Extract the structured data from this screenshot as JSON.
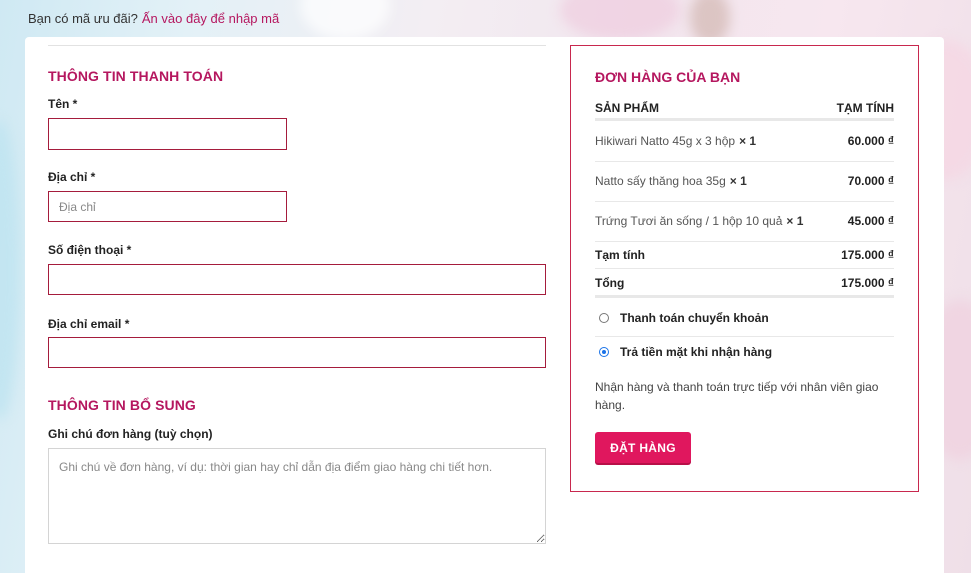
{
  "coupon": {
    "prompt": "Bạn có mã ưu đãi?",
    "link": "Ấn vào đây để nhập mã"
  },
  "billing": {
    "title": "THÔNG TIN THANH TOÁN",
    "name_label": "Tên *",
    "name_value": "",
    "address_label": "Địa chỉ *",
    "address_placeholder": "Địa chỉ",
    "phone_label": "Số điện thoại *",
    "phone_value": "",
    "email_label": "Địa chỉ email *",
    "email_value": ""
  },
  "additional": {
    "title": "THÔNG TIN BỔ SUNG",
    "notes_label": "Ghi chú đơn hàng (tuỳ chọn)",
    "notes_placeholder": "Ghi chú về đơn hàng, ví dụ: thời gian hay chỉ dẫn địa điểm giao hàng chi tiết hơn."
  },
  "order": {
    "title": "ĐƠN HÀNG CỦA BẠN",
    "col_product": "SẢN PHẨM",
    "col_subtotal": "TẠM TÍNH",
    "items": [
      {
        "name": "Hikiwari Natto 45g x 3 hộp",
        "qty": "× 1",
        "price": "60.000 ₫"
      },
      {
        "name": "Natto sấy thăng hoa 35g",
        "qty": "× 1",
        "price": "70.000 ₫"
      },
      {
        "name": "Trứng Tươi ăn sống / 1 hộp 10 quả",
        "qty": "× 1",
        "price": "45.000 ₫"
      }
    ],
    "subtotal_label": "Tạm tính",
    "subtotal_value": "175.000 ₫",
    "total_label": "Tổng",
    "total_value": "175.000 ₫"
  },
  "payment": {
    "options": [
      {
        "label": "Thanh toán chuyển khoản",
        "selected": false
      },
      {
        "label": "Trả tiền mặt khi nhận hàng",
        "selected": true
      }
    ],
    "description": "Nhận hàng và thanh toán trực tiếp với nhân viên giao hàng.",
    "place_order": "ĐẶT HÀNG"
  },
  "colors": {
    "accent": "#b5175f",
    "button": "#e0175e",
    "field_border": "#a51c3c",
    "radio_selected": "#1a73e8"
  }
}
